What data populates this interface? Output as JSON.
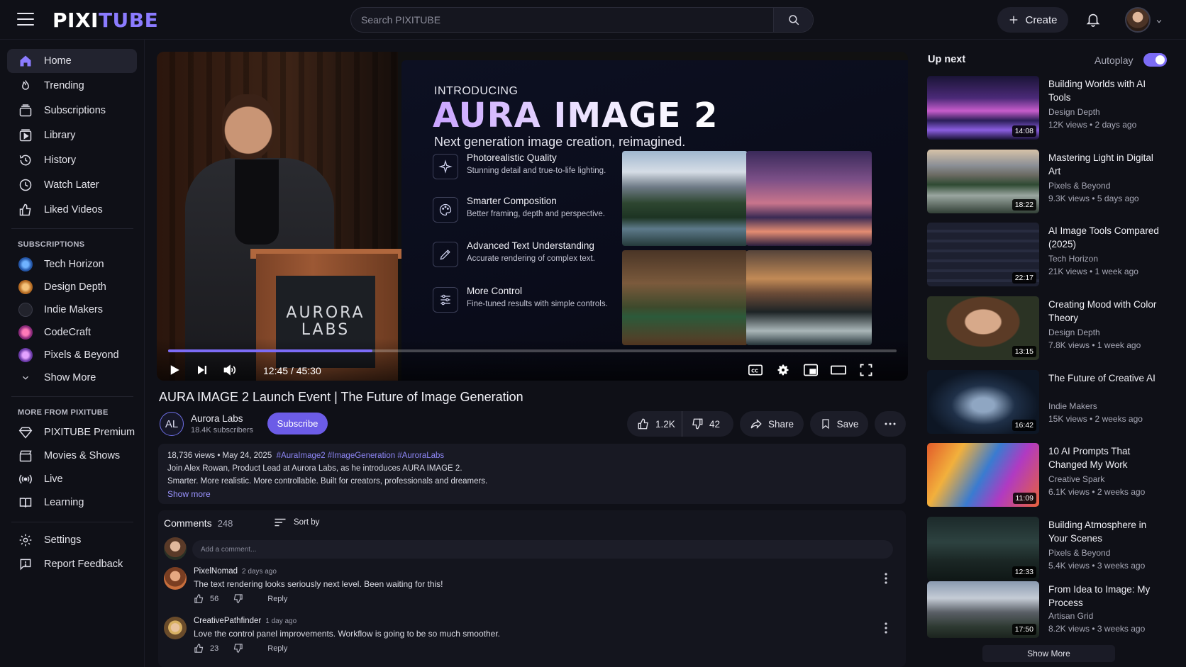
{
  "brand": {
    "part1": "PIXI",
    "part2": "TUBE"
  },
  "search": {
    "placeholder": "Search PIXITUBE"
  },
  "header": {
    "create_label": "Create"
  },
  "sidebar": {
    "main": [
      {
        "label": "Home",
        "icon": "home-icon",
        "active": true
      },
      {
        "label": "Trending",
        "icon": "flame-icon"
      },
      {
        "label": "Subscriptions",
        "icon": "subscriptions-icon"
      },
      {
        "label": "Library",
        "icon": "library-icon"
      },
      {
        "label": "History",
        "icon": "history-icon"
      },
      {
        "label": "Watch Later",
        "icon": "clock-icon"
      },
      {
        "label": "Liked Videos",
        "icon": "thumbs-up-icon"
      }
    ],
    "subscriptions_title": "SUBSCRIPTIONS",
    "subscriptions": [
      {
        "label": "Tech Horizon",
        "color": "#3b7fd9"
      },
      {
        "label": "Design Depth",
        "color": "#d98a3b"
      },
      {
        "label": "Indie Makers",
        "color": "#2b2c35"
      },
      {
        "label": "CodeCraft",
        "color": "#d94b8a"
      },
      {
        "label": "Pixels & Beyond",
        "color": "#9b5bd9"
      }
    ],
    "show_more": "Show More",
    "more_title": "MORE FROM PIXITUBE",
    "more": [
      {
        "label": "PIXITUBE Premium",
        "icon": "diamond-icon"
      },
      {
        "label": "Movies & Shows",
        "icon": "clapper-icon"
      },
      {
        "label": "Live",
        "icon": "live-icon"
      },
      {
        "label": "Learning",
        "icon": "book-icon"
      }
    ],
    "settings": "Settings",
    "feedback": "Report Feedback"
  },
  "player": {
    "podium_line1": "AURORA",
    "podium_line2": "LABS",
    "slide": {
      "intro": "INTRODUCING",
      "headline": "AURA IMAGE 2",
      "tagline": "Next generation image creation, reimagined.",
      "features": [
        {
          "title": "Photorealistic Quality",
          "desc": "Stunning detail and true-to-life lighting.",
          "icon": "sparkle-icon"
        },
        {
          "title": "Smarter Composition",
          "desc": "Better framing, depth and perspective.",
          "icon": "palette-icon"
        },
        {
          "title": "Advanced Text Understanding",
          "desc": "Accurate rendering of complex text.",
          "icon": "pen-icon"
        },
        {
          "title": "More Control",
          "desc": "Fine-tuned results with simple controls.",
          "icon": "sliders-icon"
        }
      ]
    },
    "time": "12:45 / 45:30",
    "progress_fraction": 0.28
  },
  "video": {
    "title": "AURA IMAGE 2 Launch Event | The Future of Image Generation",
    "channel_initials": "AL",
    "channel": "Aurora Labs",
    "subscribers": "18.4K subscribers",
    "subscribe": "Subscribe",
    "likes": "1.2K",
    "dislikes": "42",
    "share": "Share",
    "save": "Save"
  },
  "description": {
    "meta": "18,736 views • May 24, 2025",
    "tags": "#AuraImage2 #ImageGeneration #AuroraLabs",
    "line1": "Join Alex Rowan, Product Lead at Aurora Labs, as he introduces AURA IMAGE 2.",
    "line2": "Smarter. More realistic. More controllable. Built for creators, professionals and dreamers.",
    "show_more": "Show more"
  },
  "comments": {
    "title": "Comments",
    "count": "248",
    "sort": "Sort by",
    "placeholder": "Add a comment...",
    "items": [
      {
        "user": "PixelNomad",
        "ago": "2 days ago",
        "text": "The text rendering looks seriously next level. Been waiting for this!",
        "likes": "56",
        "reply": "Reply"
      },
      {
        "user": "CreativePathfinder",
        "ago": "1 day ago",
        "text": "Love the control panel improvements. Workflow is going to be so much smoother.",
        "likes": "23",
        "reply": "Reply"
      }
    ]
  },
  "upnext": {
    "title": "Up next",
    "autoplay": "Autoplay",
    "show_more": "Show More",
    "items": [
      {
        "title": "Building Worlds with AI Tools",
        "channel": "Design Depth",
        "meta": "12K views  •  2 days ago",
        "duration": "14:08"
      },
      {
        "title": "Mastering Light in Digital Art",
        "channel": "Pixels & Beyond",
        "meta": "9.3K views  •  5 days ago",
        "duration": "18:22"
      },
      {
        "title": "AI Image Tools Compared (2025)",
        "channel": "Tech Horizon",
        "meta": "21K views  •  1 week ago",
        "duration": "22:17"
      },
      {
        "title": "Creating Mood with Color Theory",
        "channel": "Design Depth",
        "meta": "7.8K views  •  1 week ago",
        "duration": "13:15"
      },
      {
        "title": "The Future of Creative AI",
        "channel": "Indie Makers",
        "meta": "15K views  •  2 weeks ago",
        "duration": "16:42"
      },
      {
        "title": "10 AI Prompts That Changed My Work",
        "channel": "Creative Spark",
        "meta": "6.1K views  •  2 weeks ago",
        "duration": "11:09"
      },
      {
        "title": "Building Atmosphere in Your Scenes",
        "channel": "Pixels & Beyond",
        "meta": "5.4K views  •  3 weeks ago",
        "duration": "12:33"
      },
      {
        "title": "From Idea to Image: My Process",
        "channel": "Artisan Grid",
        "meta": "8.2K views  •  3 weeks ago",
        "duration": "17:50"
      }
    ]
  },
  "colors": {
    "accent": "#7c6cf6",
    "background": "#0f1017"
  }
}
